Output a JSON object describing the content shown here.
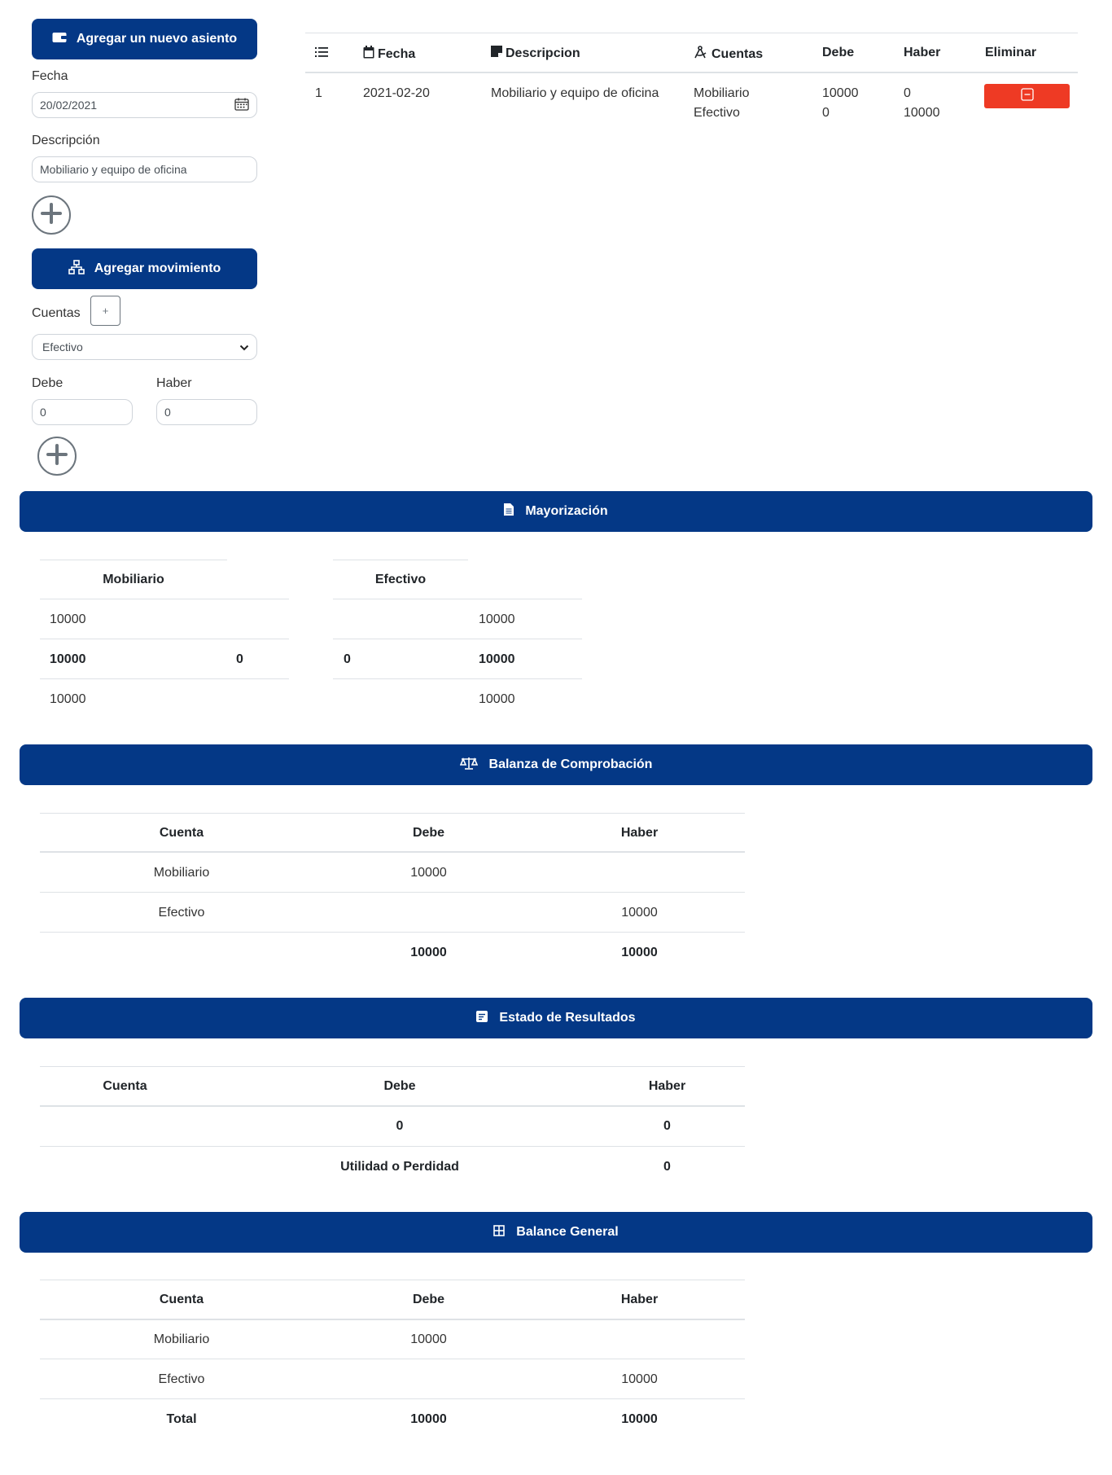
{
  "form": {
    "new_entry_button": "Agregar un nuevo asiento",
    "fecha_label": "Fecha",
    "fecha_value": "20/02/2021",
    "descripcion_label": "Descripción",
    "descripcion_value": "Mobiliario y equipo de oficina",
    "add_movement_button": "Agregar movimiento",
    "cuentas_label": "Cuentas",
    "cuentas_add": "+",
    "cuentas_selected": "Efectivo",
    "debe_label": "Debe",
    "haber_label": "Haber",
    "debe_value": "0",
    "haber_value": "0"
  },
  "journal": {
    "headers": [
      "Fecha",
      "Descripcion",
      "Cuentas",
      "Debe",
      "Haber",
      "Eliminar"
    ],
    "rows": [
      {
        "num": "1",
        "fecha": "2021-02-20",
        "descripcion": "Mobiliario y equipo de oficina",
        "cuentas": [
          "Mobiliario",
          "Efectivo"
        ],
        "debe": [
          "10000",
          "0"
        ],
        "haber": [
          "0",
          "10000"
        ]
      }
    ]
  },
  "mayorizacion": {
    "title": "Mayorización",
    "accounts": [
      {
        "name": "Mobiliario",
        "entry": "10000",
        "total_debe": "10000",
        "total_haber": "0",
        "balance": "10000"
      },
      {
        "name": "Efectivo",
        "entry": "10000",
        "total_debe": "0",
        "total_haber": "10000",
        "balance": "10000"
      }
    ]
  },
  "balanza": {
    "title": "Balanza de Comprobación",
    "headers": [
      "Cuenta",
      "Debe",
      "Haber"
    ],
    "rows": [
      {
        "cuenta": "Mobiliario",
        "debe": "10000",
        "haber": ""
      },
      {
        "cuenta": "Efectivo",
        "debe": "",
        "haber": "10000"
      }
    ],
    "totals": {
      "debe": "10000",
      "haber": "10000"
    }
  },
  "resultados": {
    "title": "Estado de Resultados",
    "headers": [
      "Cuenta",
      "Debe",
      "Haber"
    ],
    "totals": {
      "debe": "0",
      "haber": "0"
    },
    "utilidad_label": "Utilidad o Perdidad",
    "utilidad_value": "0"
  },
  "balance": {
    "title": "Balance General",
    "headers": [
      "Cuenta",
      "Debe",
      "Haber"
    ],
    "rows": [
      {
        "cuenta": "Mobiliario",
        "debe": "10000",
        "haber": ""
      },
      {
        "cuenta": "Efectivo",
        "debe": "",
        "haber": "10000"
      }
    ],
    "total_label": "Total",
    "totals": {
      "debe": "10000",
      "haber": "10000"
    }
  },
  "colors": {
    "primary": "#043886",
    "danger": "#ee3a24"
  }
}
